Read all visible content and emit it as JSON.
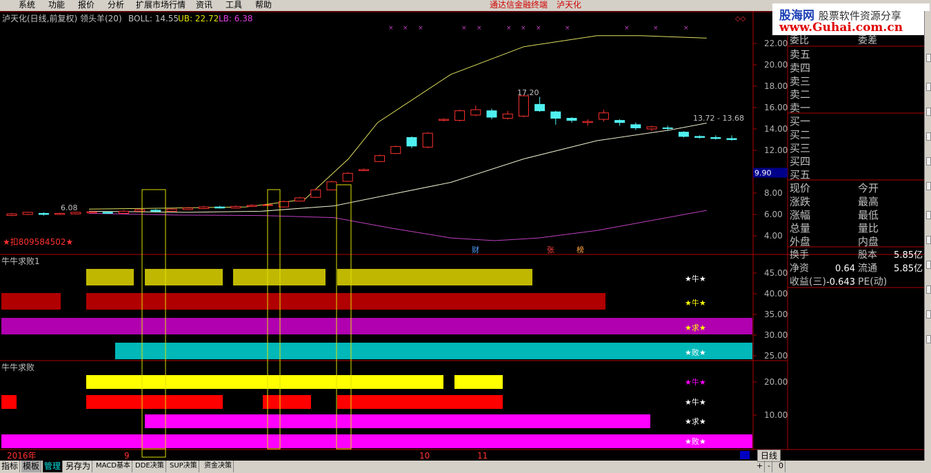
{
  "menu": {
    "items": [
      "系统",
      "功能",
      "报价",
      "分析",
      "扩展市场行情",
      "资讯",
      "工具",
      "帮助"
    ],
    "center_title": "通达信金融终端",
    "center_stock": "泸天化"
  },
  "watermark": {
    "line1a": "股海网",
    "line1b": "股票软件资源分享",
    "line2": "www.Guhai.com.cn"
  },
  "header": {
    "title": "泸天化(日线,前复权) 领头羊(20)",
    "boll": "BOLL: 14.55",
    "ub": "UB: 22.72",
    "lb": "LB: 6.38"
  },
  "main": {
    "y_ticks": [
      "22.00",
      "20.00",
      "18.00",
      "16.00",
      "14.00",
      "12.00",
      "10.00",
      "8.00",
      "6.00",
      "4.00"
    ],
    "price_tag": "9.90",
    "high_label": "17.20",
    "last_label": "13.72 - 13.68",
    "low_label": "6.08",
    "code_label": "★扣809584502★",
    "events": [
      "财",
      "张",
      "榜"
    ],
    "candles": [
      [
        5.9,
        6.05,
        5.85,
        6.15
      ],
      [
        6.0,
        6.2,
        5.95,
        6.25
      ],
      [
        6.1,
        6.0,
        5.9,
        6.2
      ],
      [
        6.0,
        6.1,
        5.95,
        6.15
      ],
      [
        6.05,
        6.2,
        6.0,
        6.25
      ],
      [
        6.15,
        6.25,
        6.1,
        6.3
      ],
      [
        6.2,
        6.1,
        6.05,
        6.3
      ],
      [
        6.1,
        6.3,
        6.05,
        6.4
      ],
      [
        6.3,
        6.45,
        6.25,
        6.5
      ],
      [
        6.4,
        6.3,
        6.25,
        6.5
      ],
      [
        6.3,
        6.5,
        6.25,
        6.55
      ],
      [
        6.45,
        6.6,
        6.4,
        6.7
      ],
      [
        6.55,
        6.7,
        6.5,
        6.8
      ],
      [
        6.7,
        6.6,
        6.55,
        6.8
      ],
      [
        6.6,
        6.75,
        6.55,
        6.85
      ],
      [
        6.75,
        6.85,
        6.7,
        6.95
      ],
      [
        6.85,
        6.9,
        6.8,
        7.0
      ],
      [
        6.7,
        7.2,
        6.65,
        7.3
      ],
      [
        7.25,
        7.55,
        7.2,
        7.65
      ],
      [
        7.6,
        8.3,
        7.55,
        8.4
      ],
      [
        8.3,
        9.05,
        8.25,
        9.15
      ],
      [
        9.1,
        9.85,
        9.05,
        9.95
      ],
      [
        10.1,
        10.2,
        10.05,
        10.3
      ],
      [
        10.95,
        11.5,
        10.9,
        11.6
      ],
      [
        11.7,
        12.35,
        11.65,
        12.45
      ],
      [
        13.2,
        12.4,
        12.2,
        13.3
      ],
      [
        12.3,
        13.6,
        12.2,
        13.7
      ],
      [
        14.8,
        14.9,
        14.7,
        15.0
      ],
      [
        14.8,
        15.7,
        14.7,
        15.8
      ],
      [
        15.3,
        15.8,
        15.2,
        16.2
      ],
      [
        15.7,
        15.1,
        14.9,
        15.9
      ],
      [
        15.0,
        15.4,
        14.9,
        15.7
      ],
      [
        15.2,
        17.1,
        15.1,
        17.2
      ],
      [
        16.3,
        15.7,
        15.6,
        17.0
      ],
      [
        15.6,
        15.0,
        14.4,
        15.7
      ],
      [
        15.0,
        14.8,
        14.6,
        15.1
      ],
      [
        14.6,
        14.7,
        14.3,
        14.9
      ],
      [
        14.9,
        15.5,
        14.7,
        15.8
      ],
      [
        14.8,
        14.6,
        14.3,
        14.9
      ],
      [
        14.4,
        14.1,
        13.9,
        14.6
      ],
      [
        14.0,
        14.2,
        13.8,
        14.3
      ],
      [
        14.1,
        14.05,
        13.8,
        14.3
      ],
      [
        13.7,
        13.3,
        13.2,
        13.8
      ],
      [
        13.3,
        13.2,
        13.1,
        13.4
      ],
      [
        13.2,
        13.1,
        13.0,
        13.4
      ],
      [
        13.1,
        13.0,
        12.9,
        13.4
      ]
    ],
    "ub_line": [
      [
        6.5,
        6.5
      ],
      [
        18,
        6.6
      ],
      [
        28,
        6.7
      ],
      [
        36,
        7.4
      ],
      [
        42,
        11.2
      ],
      [
        46,
        14.6
      ],
      [
        56,
        19.1
      ],
      [
        66,
        21.7
      ],
      [
        76,
        22.72
      ],
      [
        82,
        22.72
      ],
      [
        91,
        22.5
      ]
    ],
    "boll_line": [
      [
        6.5,
        6.3
      ],
      [
        20,
        6.2
      ],
      [
        30,
        6.3
      ],
      [
        40,
        6.8
      ],
      [
        56,
        9.0
      ],
      [
        66,
        11.2
      ],
      [
        76,
        12.9
      ],
      [
        86,
        13.9
      ],
      [
        91,
        14.55
      ]
    ],
    "lb_line": [
      [
        6.5,
        6.1
      ],
      [
        18,
        5.95
      ],
      [
        30,
        5.9
      ],
      [
        40,
        5.7
      ],
      [
        48,
        4.7
      ],
      [
        56,
        3.8
      ],
      [
        62,
        3.55
      ],
      [
        68,
        3.8
      ],
      [
        76,
        4.5
      ],
      [
        91,
        6.38
      ]
    ]
  },
  "panel1": {
    "title": "牛牛求败1",
    "y_ticks": [
      "45.00",
      "40.00",
      "35.00",
      "30.00",
      "25.00"
    ],
    "labels": [
      "★牛★",
      "★牛★",
      "★求★",
      "★败★"
    ],
    "colors": [
      "#c0b800",
      "#b00000",
      "#b000b0",
      "#00b8b8"
    ],
    "label_colors": [
      "#ffffff",
      "#ffff00",
      "#ffff00",
      "#ffffff"
    ],
    "rows": [
      [
        [
          125,
          194
        ],
        [
          210,
          323
        ],
        [
          338,
          472
        ],
        [
          489,
          772
        ]
      ],
      [
        [
          2,
          88
        ],
        [
          125,
          878
        ]
      ],
      [
        [
          2,
          1091
        ]
      ],
      [
        [
          167,
          1091
        ]
      ]
    ]
  },
  "panel2": {
    "title": "牛牛求败",
    "y_ticks": [
      "20.00",
      "10.00"
    ],
    "labels": [
      "★牛★",
      "★牛★",
      "★求★",
      "★败★"
    ],
    "colors": [
      "#ffff00",
      "#ff0000",
      "#ff00ff",
      "#ff00ff"
    ],
    "label_colors": [
      "#ff00ff",
      "#ffffff",
      "#ffffff",
      "#ffffff"
    ],
    "rows": [
      [
        [
          125,
          643
        ],
        [
          659,
          729
        ]
      ],
      [
        [
          2,
          24
        ],
        [
          125,
          323
        ],
        [
          381,
          451
        ],
        [
          489,
          729
        ]
      ],
      [
        [
          210,
          943
        ]
      ],
      [
        [
          2,
          1091
        ]
      ]
    ]
  },
  "x_axis": {
    "labels": [
      "2016年",
      "9",
      "10",
      "11"
    ]
  },
  "quote": {
    "header": [
      "委比",
      "委差"
    ],
    "sell": [
      "卖五",
      "卖四",
      "卖三",
      "卖二",
      "卖一"
    ],
    "buy": [
      "买一",
      "买二",
      "买三",
      "买四",
      "买五"
    ],
    "grid": [
      [
        "现价",
        "今开"
      ],
      [
        "涨跌",
        "最高"
      ],
      [
        "涨幅",
        "最低"
      ],
      [
        "总量",
        "量比"
      ],
      [
        "外盘",
        "内盘"
      ]
    ],
    "fin": [
      {
        "l1": "换手",
        "v1": "",
        "l2": "股本",
        "v2": "5.85亿"
      },
      {
        "l1": "净资",
        "v1": "0.64",
        "l2": "流通",
        "v2": "5.85亿"
      },
      {
        "l1": "收益(三)",
        "v1": "-0.643",
        "l2": "PE(动)",
        "v2": ""
      }
    ]
  },
  "bottom": {
    "tabs": [
      "指标",
      "模板",
      "管理",
      "另存为",
      "MACD基本",
      "DDE决策",
      "SUP决策",
      "资金决策"
    ],
    "period": "日线",
    "controls": [
      "+",
      "-",
      "0"
    ]
  }
}
